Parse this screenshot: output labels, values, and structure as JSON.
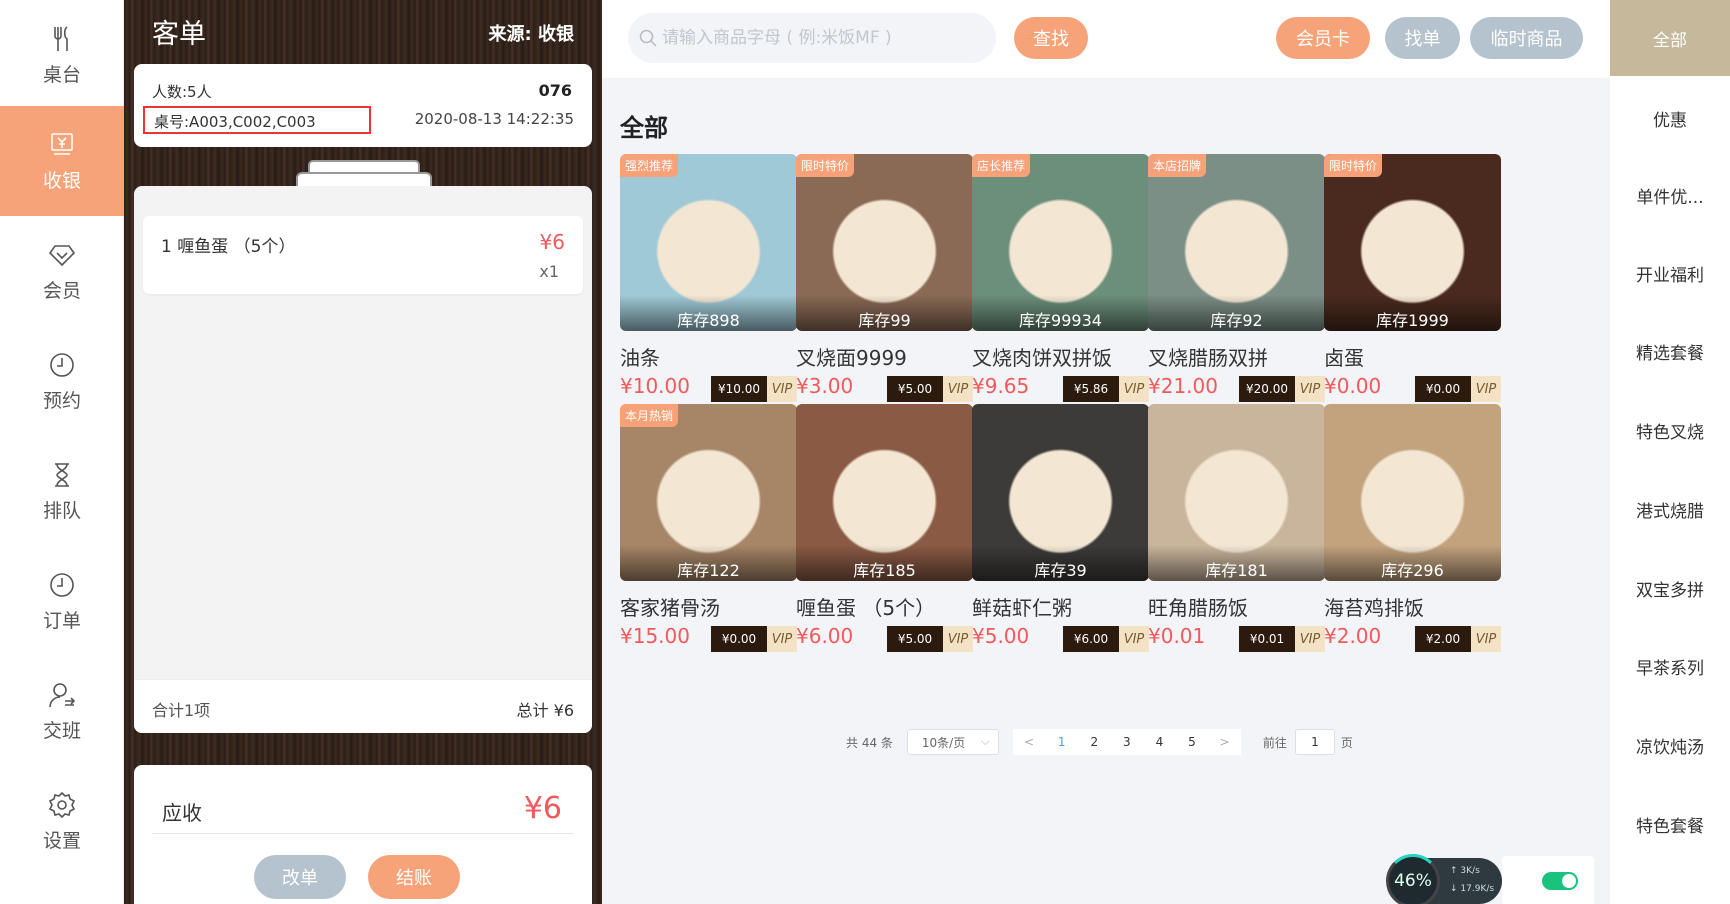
{
  "nav": [
    {
      "label": "桌台",
      "icon": "fork-knife-icon"
    },
    {
      "label": "收银",
      "icon": "cashier-icon",
      "active": true
    },
    {
      "label": "会员",
      "icon": "diamond-icon"
    },
    {
      "label": "预约",
      "icon": "clock-icon"
    },
    {
      "label": "排队",
      "icon": "hourglass-icon"
    },
    {
      "label": "订单",
      "icon": "clock-icon"
    },
    {
      "label": "交班",
      "icon": "user-switch-icon"
    },
    {
      "label": "设置",
      "icon": "gear-icon"
    }
  ],
  "order": {
    "title": "客单",
    "source": "来源: 收银",
    "people": "人数:5人",
    "number": "076",
    "table": "桌号:A003,C002,C003",
    "time": "2020-08-13 14:22:35",
    "items": [
      {
        "name": "1 喱鱼蛋 （5个）",
        "price": "¥6",
        "qty": "x1"
      }
    ],
    "count_text": "合计1项",
    "total_text": "总计 ¥6",
    "receivable_label": "应收",
    "receivable_amount": "¥6",
    "modify_label": "改单",
    "checkout_label": "结账"
  },
  "toolbar": {
    "search_placeholder": "请输入商品字母 ( 例:米饭MF )",
    "find_label": "查找",
    "member_card_label": "会员卡",
    "find_order_label": "找单",
    "temp_goods_label": "临时商品"
  },
  "section_title": "全部",
  "products": [
    {
      "name": "油条",
      "price": "¥10.00",
      "vip_price": "¥10.00",
      "vip_label": "VIP",
      "stock": "库存898",
      "badge": "强烈推荐",
      "bg": "#9fc9d6"
    },
    {
      "name": "叉烧面9999",
      "price": "¥3.00",
      "vip_price": "¥5.00",
      "vip_label": "VIP",
      "stock": "库存99",
      "badge": "限时特价",
      "bg": "#8a6a55"
    },
    {
      "name": "叉烧肉饼双拼饭",
      "price": "¥9.65",
      "vip_price": "¥5.86",
      "vip_label": "VIP",
      "stock": "库存99934",
      "badge": "店长推荐",
      "bg": "#6b8f7a"
    },
    {
      "name": "叉烧腊肠双拼",
      "price": "¥21.00",
      "vip_price": "¥20.00",
      "vip_label": "VIP",
      "stock": "库存92",
      "badge": "本店招牌",
      "bg": "#7b8f86"
    },
    {
      "name": "卤蛋",
      "price": "¥0.00",
      "vip_price": "¥0.00",
      "vip_label": "VIP",
      "stock": "库存1999",
      "badge": "限时特价",
      "bg": "#4a2a1e"
    },
    {
      "name": "客家猪骨汤",
      "price": "¥15.00",
      "vip_price": "¥0.00",
      "vip_label": "VIP",
      "stock": "库存122",
      "badge": "本月热销",
      "bg": "#a68667"
    },
    {
      "name": "喱鱼蛋 （5个）",
      "price": "¥6.00",
      "vip_price": "¥5.00",
      "vip_label": "VIP",
      "stock": "库存185",
      "badge": "",
      "bg": "#8a5a45"
    },
    {
      "name": "鲜菇虾仁粥",
      "price": "¥5.00",
      "vip_price": "¥6.00",
      "vip_label": "VIP",
      "stock": "库存39",
      "badge": "",
      "bg": "#3d3b39"
    },
    {
      "name": "旺角腊肠饭",
      "price": "¥0.01",
      "vip_price": "¥0.01",
      "vip_label": "VIP",
      "stock": "库存181",
      "badge": "",
      "bg": "#c9b59c"
    },
    {
      "name": "海苔鸡排饭",
      "price": "¥2.00",
      "vip_price": "¥2.00",
      "vip_label": "VIP",
      "stock": "库存296",
      "badge": "",
      "bg": "#c2a37e"
    }
  ],
  "pagination": {
    "total_text": "共 44 条",
    "page_size": "10条/页",
    "pages": [
      "1",
      "2",
      "3",
      "4",
      "5"
    ],
    "current": "1",
    "prev": "<",
    "next": ">",
    "goto_label": "前往",
    "goto_value": "1",
    "page_unit": "页"
  },
  "net_widget": {
    "percent": "46%",
    "up": "3K/s",
    "down": "17.9K/s"
  },
  "categories": [
    {
      "label": "全部",
      "active": true
    },
    {
      "label": "优惠"
    },
    {
      "label": "单件优..."
    },
    {
      "label": "开业福利"
    },
    {
      "label": "精选套餐"
    },
    {
      "label": "特色叉烧"
    },
    {
      "label": "港式烧腊"
    },
    {
      "label": "双宝多拼"
    },
    {
      "label": "早茶系列"
    },
    {
      "label": "凉饮炖汤"
    },
    {
      "label": "特色套餐"
    }
  ]
}
